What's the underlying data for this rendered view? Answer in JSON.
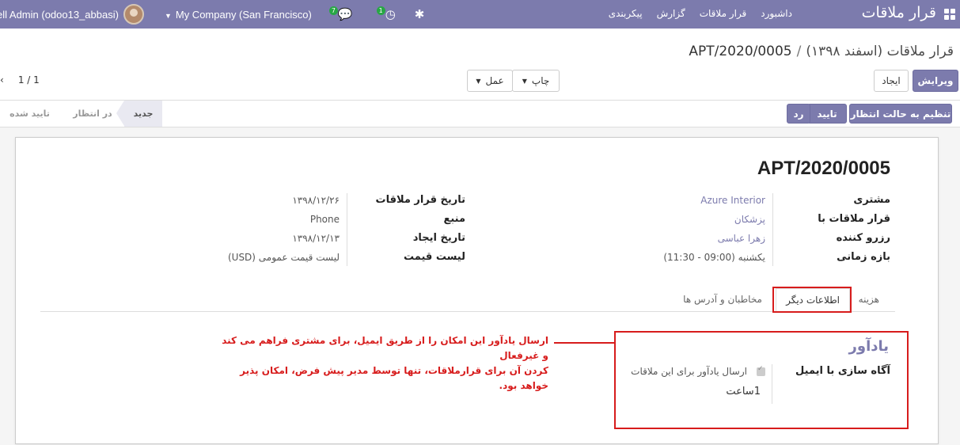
{
  "navbar": {
    "brand": "قرار ملاقات",
    "menu": [
      "داشبورد",
      "قرار ملاقات",
      "گزارش",
      "پیکربندی"
    ],
    "user": "ell Admin (odoo13_abbasi)",
    "company": "My Company (San Francisco)",
    "chat_count": "7",
    "activity_count": "1"
  },
  "breadcrumb": {
    "parent": "قرار ملاقات (اسفند ۱۳۹۸)",
    "separator": "/",
    "current": "APT/2020/0005"
  },
  "pager": {
    "value": "1 / 1"
  },
  "toolbar": {
    "edit": "ویرایش",
    "create": "ایجاد",
    "print": "چاپ",
    "action": "عمل"
  },
  "status_buttons": {
    "set_pending": "تنظیم به حالت انتظار",
    "confirm": "تایید",
    "reject": "رد"
  },
  "stages": {
    "new": "جدید",
    "pending": "در انتظار",
    "confirmed": "تایید شده"
  },
  "record": {
    "title": "APT/2020/0005",
    "customer_label": "مشتری",
    "customer": "Azure Interior",
    "appointment_with_label": "قرار ملاقات با",
    "appointment_with": "پزشکان",
    "booked_by_label": "رزرو کننده",
    "booked_by": "زهرا عباسی",
    "timeslot_label": "بازه زمانی",
    "timeslot": "یکشنبه (09:00 - 11:30)",
    "date_label": "تاریخ قرار ملاقات",
    "date": "۱۳۹۸/۱۲/۲۶",
    "source_label": "منبع",
    "source": "Phone",
    "created_label": "تاریخ ایجاد",
    "created": "۱۳۹۸/۱۲/۱۳",
    "pricelist_label": "لیست قیمت",
    "pricelist": "لیست قیمت عمومی (USD)"
  },
  "tabs": [
    "هزینه",
    "اطلاعات دیگر",
    "مخاطبان و آدرس ها"
  ],
  "reminder": {
    "group_title": "یادآور",
    "label": "آگاه سازی با ایمیل",
    "checkbox_label": "ارسال یادآور برای این ملاقات",
    "duration": "1ساعت"
  },
  "annotation": {
    "line1": "ارسال یادآور این امکان را از طریق ایمیل، برای مشتری فراهم می کند و غیرفعال",
    "line2": "کردن آن برای قرارملاقات، تنها توسط مدیر پیش فرض، امکان پذیر خواهد بود."
  },
  "colors": {
    "brand": "#7c7bad",
    "highlight": "#d71c1c"
  }
}
